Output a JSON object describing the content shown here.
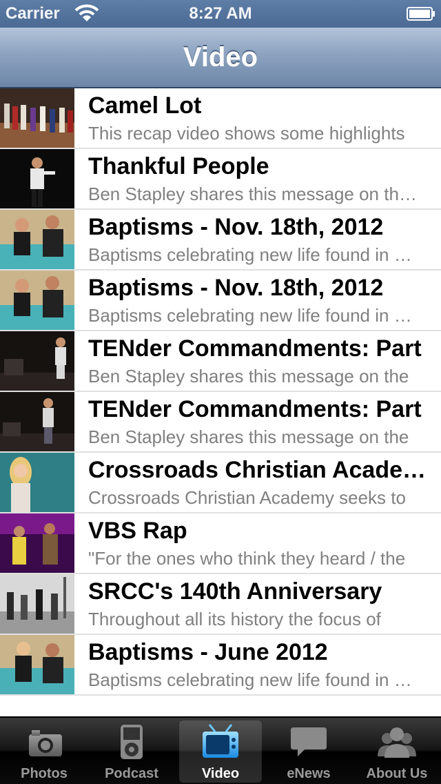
{
  "status_bar": {
    "carrier": "Carrier",
    "time": "8:27 AM"
  },
  "nav": {
    "title": "Video"
  },
  "videos": [
    {
      "title": "Camel Lot",
      "subtitle": "This recap video shows some highlights"
    },
    {
      "title": "Thankful People",
      "subtitle": "Ben Stapley shares this message on thankfulness"
    },
    {
      "title": "Baptisms - Nov. 18th, 2012",
      "subtitle": "Baptisms celebrating new life found in Christ"
    },
    {
      "title": "Baptisms - Nov. 18th, 2012",
      "subtitle": "Baptisms celebrating new life found in Christ"
    },
    {
      "title": "TENder Commandments: Part",
      "subtitle": "Ben Stapley shares this message on the"
    },
    {
      "title": "TENder Commandments: Part",
      "subtitle": "Ben Stapley shares this message on the"
    },
    {
      "title": "Crossroads Christian Academy",
      "subtitle": "Crossroads Christian Academy seeks to"
    },
    {
      "title": "VBS Rap",
      "subtitle": "\"For the ones who think they heard / the"
    },
    {
      "title": "SRCC's 140th Anniversary",
      "subtitle": "Throughout all its history the focus of"
    },
    {
      "title": "Baptisms - June 2012",
      "subtitle": "Baptisms celebrating new life found in Christ"
    }
  ],
  "tabs": [
    {
      "label": "Photos",
      "icon": "camera-icon",
      "active": false
    },
    {
      "label": "Podcast",
      "icon": "ipod-icon",
      "active": false
    },
    {
      "label": "Video",
      "icon": "tv-icon",
      "active": true
    },
    {
      "label": "eNews",
      "icon": "speech-bubble-icon",
      "active": false
    },
    {
      "label": "About Us",
      "icon": "people-icon",
      "active": false
    }
  ],
  "colors": {
    "nav_accent": "#6d86a8",
    "active_tab_icon": "#3aa8ef"
  }
}
